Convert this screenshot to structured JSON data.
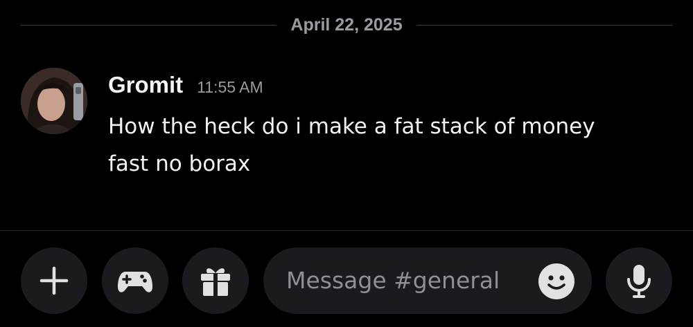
{
  "date_divider": {
    "text": "April 22, 2025"
  },
  "message": {
    "author": "Gromit",
    "time": "11:55 AM",
    "lines": [
      "How the heck do i make a fat stack of money",
      "fast no borax"
    ]
  },
  "composer": {
    "placeholder": "Message #general",
    "buttons": {
      "attach_icon": "plus-icon",
      "activities_icon": "gamepad-icon",
      "gift_icon": "gift-icon",
      "emoji_icon": "smiley-icon",
      "voice_icon": "microphone-icon"
    }
  },
  "colors": {
    "background": "#000000",
    "text": "#f2f3f5",
    "muted": "#9a9ca3",
    "button_bg": "#1a1b1f",
    "icon": "#dfe1e5"
  }
}
